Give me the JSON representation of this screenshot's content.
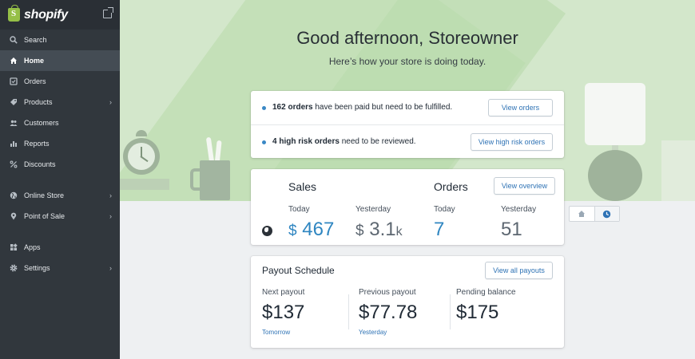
{
  "brand": {
    "name": "shopify"
  },
  "sidebar": {
    "items": [
      {
        "label": "Search",
        "icon": "search-icon"
      },
      {
        "label": "Home",
        "icon": "home-icon",
        "active": true
      },
      {
        "label": "Orders",
        "icon": "orders-icon"
      },
      {
        "label": "Products",
        "icon": "tag-icon",
        "chevron": true
      },
      {
        "label": "Customers",
        "icon": "customers-icon"
      },
      {
        "label": "Reports",
        "icon": "reports-icon"
      },
      {
        "label": "Discounts",
        "icon": "discount-icon"
      },
      {
        "label": "Online Store",
        "icon": "globe-icon",
        "chevron": true
      },
      {
        "label": "Point of Sale",
        "icon": "pin-icon",
        "chevron": true
      },
      {
        "label": "Apps",
        "icon": "apps-icon"
      },
      {
        "label": "Settings",
        "icon": "gear-icon",
        "chevron": true
      }
    ]
  },
  "hero": {
    "title": "Good afternoon, Storeowner",
    "subtitle": "Here’s how your store is doing today."
  },
  "tasks": [
    {
      "bold": "162 orders",
      "text": " have been paid but need to be fulfilled.",
      "button": "View orders"
    },
    {
      "bold": "4 high risk orders",
      "text": " need to be reviewed.",
      "button": "View high risk orders"
    }
  ],
  "sales": {
    "title": "Sales",
    "today_label": "Today",
    "today_currency": "$",
    "today_value": "467",
    "yesterday_label": "Yesterday",
    "yesterday_currency": "$",
    "yesterday_value": "3.1",
    "yesterday_suffix": "k"
  },
  "orders": {
    "title": "Orders",
    "button": "View overview",
    "today_label": "Today",
    "today_value": "7",
    "yesterday_label": "Yesterday",
    "yesterday_value": "51"
  },
  "payout": {
    "title": "Payout Schedule",
    "button": "View all payouts",
    "columns": [
      {
        "label": "Next payout",
        "value": "$137",
        "sub": "Tomorrow"
      },
      {
        "label": "Previous payout",
        "value": "$77.78",
        "sub": "Yesterday"
      },
      {
        "label": "Pending balance",
        "value": "$175",
        "sub": ""
      }
    ]
  },
  "colors": {
    "accent": "#2f86c1",
    "sidebar_bg": "#31373d",
    "hero_bg": "#d3e7cb",
    "brand_green": "#95bf47"
  }
}
